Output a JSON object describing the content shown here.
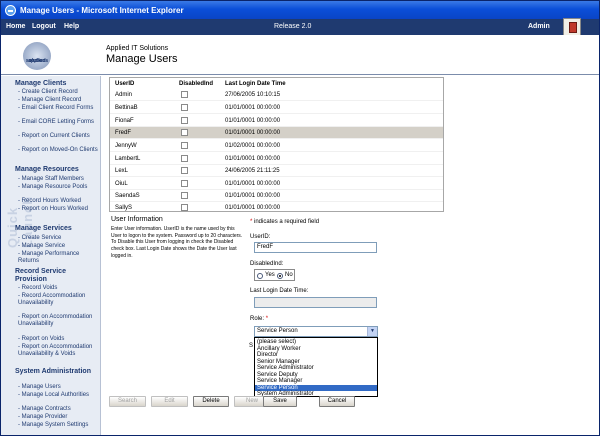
{
  "window": {
    "title": "Manage Users - Microsoft Internet Explorer"
  },
  "topnav": {
    "items": [
      "Home",
      "Logout",
      "Help"
    ],
    "release": "Release 2.0",
    "user": "Admin"
  },
  "header": {
    "logo_text_1": "applied",
    "logo_text_2": "solutions",
    "company": "Applied IT Solutions",
    "title": "Manage Users"
  },
  "sidebar": {
    "watermark": "Quick Launch",
    "sections": [
      {
        "title": "Manage Clients",
        "links": [
          "Create Client Record",
          "Manage Client Record",
          "Email Client Record Forms",
          "Email CORE Letting Forms",
          "Report on Current Clients",
          "Report on Moved-On Clients"
        ]
      },
      {
        "title": "Manage Resources",
        "links": [
          "Manage Staff Members",
          "Manage Resource Pools",
          "Record Hours Worked",
          "Report on Hours Worked"
        ]
      },
      {
        "title": "Manage Services",
        "links": [
          "Create Service",
          "Manage Service",
          "Manage Performance Returns"
        ]
      },
      {
        "title": "Record Service Provision",
        "links": [
          "Record Voids",
          "Record Accommodation Unavailability",
          "Report on Accommodation Unavailability",
          "Report on Voids",
          "Report on Accommodation Unavailability & Voids"
        ]
      },
      {
        "title": "System Administration",
        "links": [
          "Manage Users",
          "Manage Local Authorities",
          "Manage Contracts",
          "Manage Provider",
          "Manage System Settings"
        ]
      }
    ]
  },
  "grid": {
    "headers": [
      "UserID",
      "DisabledInd",
      "Last Login Date Time"
    ],
    "rows": [
      {
        "user": "Admin",
        "last": "27/06/2005 10:10:15",
        "selected": false
      },
      {
        "user": "BettinaB",
        "last": "01/01/0001 00:00:00",
        "selected": false
      },
      {
        "user": "FionaF",
        "last": "01/01/0001 00:00:00",
        "selected": false
      },
      {
        "user": "FredF",
        "last": "01/01/0001 00:00:00",
        "selected": true
      },
      {
        "user": "JennyW",
        "last": "01/02/0001 00:00:00",
        "selected": false
      },
      {
        "user": "LambertL",
        "last": "01/01/0001 00:00:00",
        "selected": false
      },
      {
        "user": "LexL",
        "last": "24/06/2005 21:11:25",
        "selected": false
      },
      {
        "user": "OiuL",
        "last": "01/01/0001 00:00:00",
        "selected": false
      },
      {
        "user": "SaendaS",
        "last": "01/01/0001 00:00:00",
        "selected": false
      },
      {
        "user": "SallyS",
        "last": "01/01/0001 00:00:00",
        "selected": false
      }
    ]
  },
  "info": {
    "title": "User Information",
    "text": "Enter User information. UserID is the name used by this User to logon to the system. Password up to 20 characters. To Disable this User from logging in check the Disabled check box. Last Login Date shows the Date the User last logged in."
  },
  "form": {
    "required_note": "indicates a required field",
    "userid_label": "UserID:",
    "userid_value": "FredF",
    "disabled_label": "DisabledInd:",
    "yes_label": "Yes",
    "no_label": "No",
    "last_login_label": "Last Login Date Time:",
    "role_label": "Role:",
    "role_value": "Service Person",
    "partial_letter": "S",
    "role_options": [
      "(please select)",
      "Ancillary Worker",
      "Director",
      "Senior Manager",
      "Service Administrator",
      "Service Deputy",
      "Service Manager",
      "Service Person",
      "System Administrator"
    ],
    "highlighted_option": "Service Person"
  },
  "buttons": {
    "search": "Search",
    "edit": "Edit",
    "delete": "Delete",
    "new": "New",
    "save": "Save",
    "cancel": "Cancel"
  }
}
